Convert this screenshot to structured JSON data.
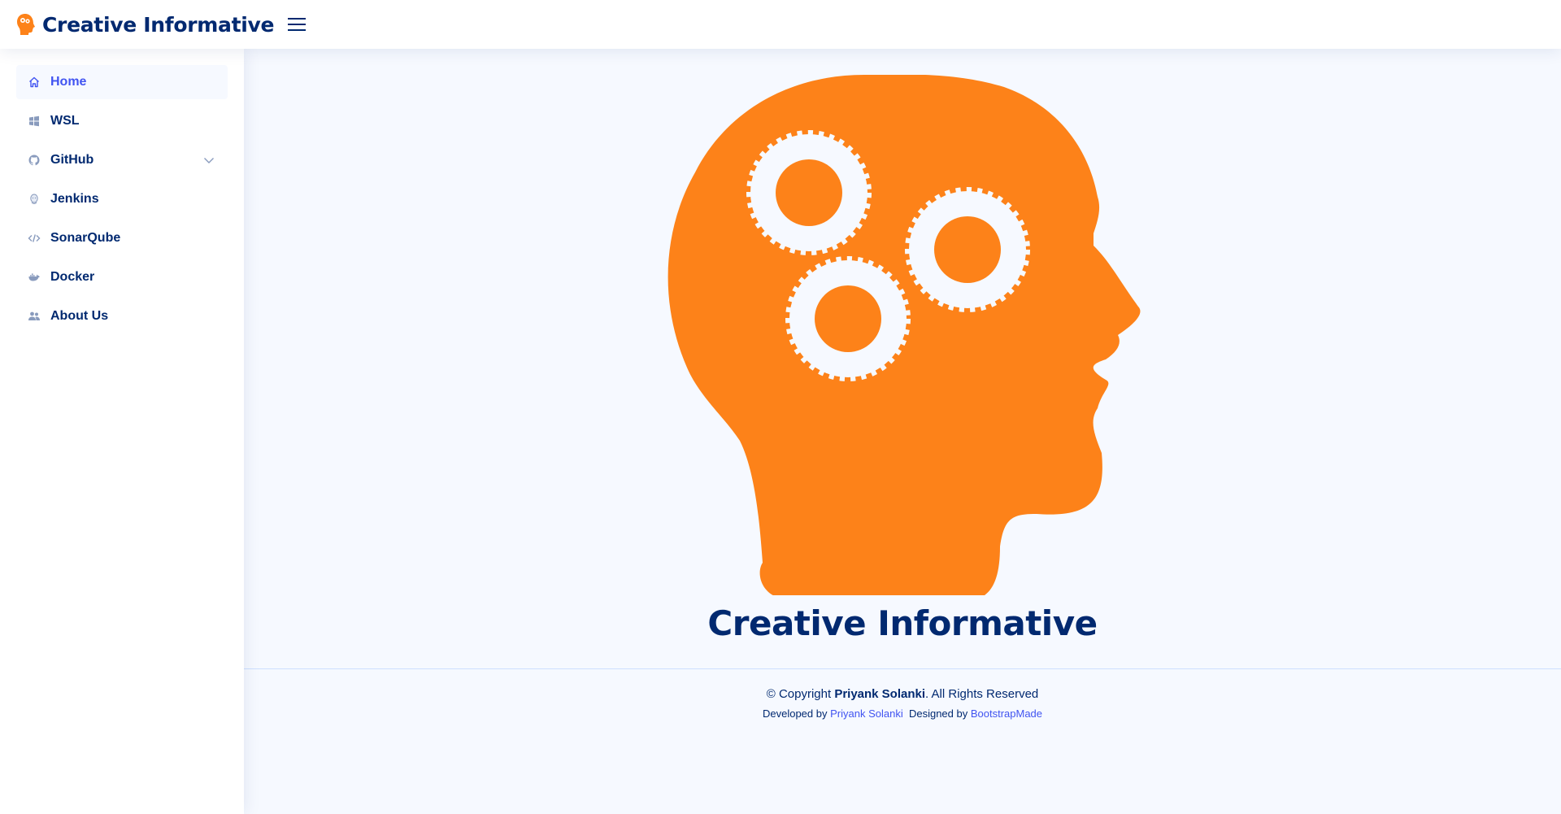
{
  "header": {
    "brand": "Creative Informative",
    "logo_icon": "head-gears-icon",
    "menu_icon": "hamburger-menu-icon"
  },
  "sidebar": {
    "items": [
      {
        "label": "Home",
        "icon": "house-icon",
        "active": true
      },
      {
        "label": "WSL",
        "icon": "windows-icon"
      },
      {
        "label": "GitHub",
        "icon": "github-icon",
        "expandable": true
      },
      {
        "label": "Jenkins",
        "icon": "jenkins-icon"
      },
      {
        "label": "SonarQube",
        "icon": "code-icon"
      },
      {
        "label": "Docker",
        "icon": "docker-icon"
      },
      {
        "label": "About Us",
        "icon": "people-icon"
      }
    ]
  },
  "main": {
    "title": "Creative Informative"
  },
  "footer": {
    "copyright_prefix": "© Copyright ",
    "copyright_name": "Priyank Solanki",
    "copyright_suffix": ". All Rights Reserved",
    "developed_by_label": "Developed by ",
    "developer_link": "Priyank Solanki",
    "designed_by_label": "Designed by ",
    "designer_link": "BootstrapMade"
  },
  "colors": {
    "brand_navy": "#012970",
    "accent_blue": "#4154f1",
    "head_orange": "#fd8219",
    "background": "#f6f9ff"
  }
}
